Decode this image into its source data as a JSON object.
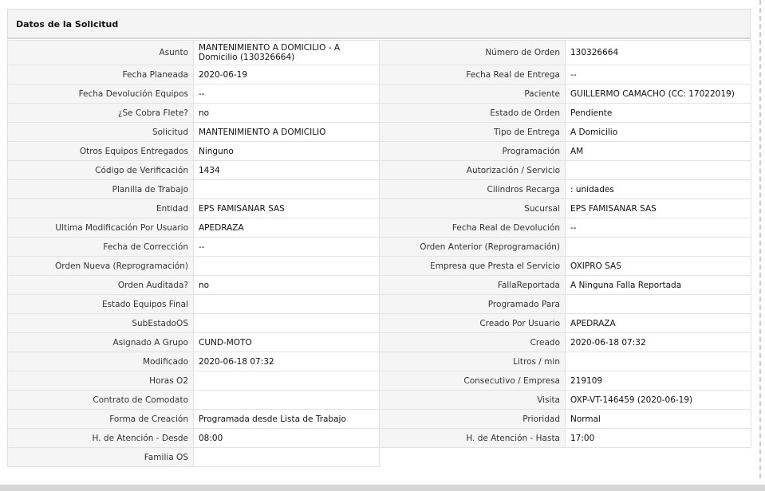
{
  "panel": {
    "title": "Datos de la Solicitud"
  },
  "rows": [
    {
      "l1": "Asunto",
      "v1": "MANTENIMIENTO A DOMICILIO - A Domicilio (130326664)",
      "l2": "Número de Orden",
      "v2": "130326664"
    },
    {
      "l1": "Fecha Planeada",
      "v1": " 2020-06-19",
      "l2": "Fecha Real de Entrega",
      "v2": " --"
    },
    {
      "l1": "Fecha Devolución Equipos",
      "v1": " --",
      "l2": "Paciente",
      "v2": "GUILLERMO CAMACHO (CC: 17022019)"
    },
    {
      "l1": "¿Se Cobra Flete?",
      "v1": " no",
      "l2": "Estado de Orden",
      "v2": "Pendiente"
    },
    {
      "l1": "Solicitud",
      "v1": "MANTENIMIENTO A DOMICILIO",
      "l2": "Tipo de Entrega",
      "v2": "A Domicilio"
    },
    {
      "l1": "Otros Equipos Entregados",
      "v1": "Ninguno",
      "l2": "Programación",
      "v2": "AM"
    },
    {
      "l1": "Código de Verificación",
      "v1": "1434",
      "l2": "Autorización / Servicio",
      "v2": ""
    },
    {
      "l1": "Planilla de Trabajo",
      "v1": "",
      "l2": "Cilindros Recarga",
      "v2": ": unidades"
    },
    {
      "l1": "Entidad",
      "v1": "EPS FAMISANAR SAS",
      "l2": "Sucursal",
      "v2": "EPS FAMISANAR SAS"
    },
    {
      "l1": "Ultima Modificación Por Usuario",
      "v1": "APEDRAZA",
      "l2": "Fecha Real de Devolución",
      "v2": " --"
    },
    {
      "l1": "Fecha de Corrección",
      "v1": " --",
      "l2": "Orden Anterior (Reprogramación)",
      "v2": ""
    },
    {
      "l1": "Orden Nueva (Reprogramación)",
      "v1": "",
      "l2": "Empresa que Presta el Servicio",
      "v2": "OXIPRO SAS"
    },
    {
      "l1": "Orden Auditada?",
      "v1": " no",
      "l2": "FallaReportada",
      "v2": "A Ninguna Falla Reportada"
    },
    {
      "l1": "Estado Equipos Final",
      "v1": "",
      "l2": "Programado Para",
      "v2": ""
    },
    {
      "l1": "SubEstadoOS",
      "v1": "",
      "l2": "Creado Por Usuario",
      "v2": "APEDRAZA"
    },
    {
      "l1": "Asignado A Grupo",
      "v1": "CUND-MOTO",
      "l2": "Creado",
      "v2": "2020-06-18 07:32"
    },
    {
      "l1": "Modificado",
      "v1": "2020-06-18 07:32",
      "l2": "Litros / min",
      "v2": ""
    },
    {
      "l1": "Horas O2",
      "v1": "",
      "l2": "Consecutivo / Empresa",
      "v2": "219109"
    },
    {
      "l1": "Contrato de Comodato",
      "v1": "",
      "l2": "Visita",
      "v2": "OXP-VT-146459 (2020-06-19)"
    },
    {
      "l1": "Forma de Creación",
      "v1": "Programada desde Lista de Trabajo",
      "l2": "Prioridad",
      "v2": "Normal"
    },
    {
      "l1": "H. de Atención - Desde",
      "v1": "08:00",
      "l2": "H. de Atención - Hasta",
      "v2": "17:00"
    },
    {
      "l1": "Familia OS",
      "v1": ""
    }
  ]
}
